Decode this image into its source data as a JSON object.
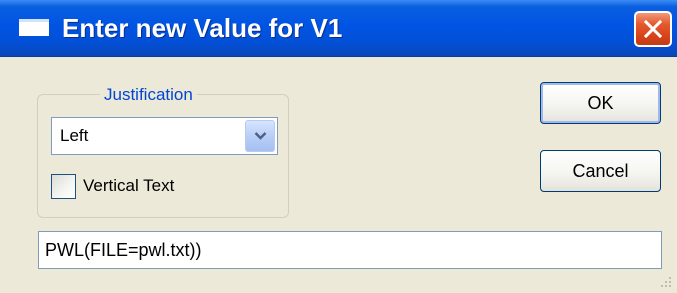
{
  "window": {
    "title": "Enter new Value for V1",
    "colors": {
      "titlebar": "#0054E3",
      "background": "#ECE9D8",
      "close_button": "#D9441B",
      "legend_text": "#0046D5"
    }
  },
  "justification": {
    "legend": "Justification",
    "selected": "Left"
  },
  "vertical_text": {
    "label": "Vertical Text",
    "checked": false
  },
  "buttons": {
    "ok": "OK",
    "cancel": "Cancel"
  },
  "value_field": {
    "value": "PWL(FILE=pwl.txt))"
  },
  "icons": {
    "window_icon": "window-icon",
    "close": "close-icon",
    "dropdown": "chevron-down-icon",
    "grip": "resize-grip-icon"
  }
}
